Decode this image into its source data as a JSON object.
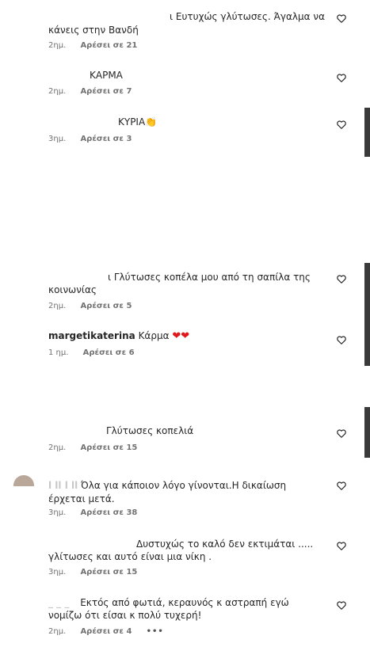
{
  "comments": [
    {
      "text_line1": "ι Ευτυχώς γλύτωσες. Άγαλμα να",
      "text_line2": "κάνεις στην Βανδή",
      "time": "2ημ.",
      "likes": "Αρέσει σε 21",
      "reply": ""
    },
    {
      "text_line1": "ΚΑΡΜΑ",
      "time": "2ημ.",
      "likes": "Αρέσει σε 7"
    },
    {
      "text_line1": "ΚΥΡΙΑ👏",
      "time": "3ημ.",
      "likes": "Αρέσει σε 3"
    },
    {
      "text_line1": "ι Γλύτωσες κοπέλα μου από τη σαπίλα της",
      "text_line2": "κοινωνίας",
      "time": "2ημ.",
      "likes": "Αρέσει σε 5"
    },
    {
      "username": "margetikaterina",
      "text_line1": "Κάρμα",
      "hearts": "❤❤",
      "time": "1 ημ.",
      "likes": "Αρέσει σε 6"
    },
    {
      "text_line1": "Γλύτωσες κοπελιά",
      "time": "2ημ.",
      "likes": "Αρέσει σε 15"
    },
    {
      "username_partial": "l    ll      l     ll",
      "text_line1": "Όλα για κάποιον λόγο γίνονται.Η δικαίωση",
      "text_line2": "έρχεται μετά.",
      "time": "3ημ.",
      "likes": "Αρέσει σε 38"
    },
    {
      "text_line1": "Δυστυχώς το καλό δεν εκτιμάται .....",
      "text_line2": "γλίτωσες και αυτό είναι μια νίκη .",
      "time": "3ημ.",
      "likes": "Αρέσει σε 15"
    },
    {
      "username_partial": "_  _    _",
      "text_line1": "Εκτός από φωτιά, κεραυνός κ αστραπή εγώ",
      "text_line2": "νομίζω ότι είσαι κ πολύ τυχερή!",
      "time": "2ημ.",
      "likes": "Αρέσει σε 4",
      "more": "•••"
    }
  ],
  "colors": {
    "text": "#262626",
    "meta": "#737373",
    "heart_red": "#e0181b",
    "edge_bar": "#3a3a3a"
  },
  "icons": {
    "like": "heart-outline-icon",
    "more": "more-options-icon"
  }
}
